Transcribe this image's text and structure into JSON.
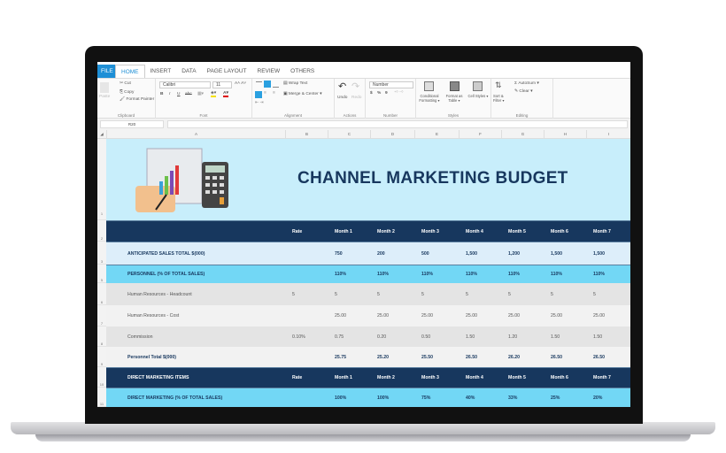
{
  "ribbon": {
    "tabs": [
      "FILE",
      "HOME",
      "INSERT",
      "DATA",
      "PAGE LAYOUT",
      "REVIEW",
      "OTHERS"
    ],
    "clipboard": {
      "paste": "Paste",
      "cut": "Cut",
      "copy": "Copy",
      "format_painter": "Format Painter",
      "label": "Clipboard"
    },
    "font": {
      "name": "Calibri",
      "size": "11",
      "bold": "B",
      "italic": "I",
      "underline": "U",
      "strike": "abc",
      "label": "Font"
    },
    "alignment": {
      "wrap": "Wrap Text",
      "merge": "Merge & Center",
      "label": "Alignment"
    },
    "actions": {
      "undo": "Undo",
      "redo": "Redo",
      "label": "Actions"
    },
    "number": {
      "format": "Number",
      "currency": "$",
      "percent": "%",
      "comma": "9",
      "label": "Number"
    },
    "styles": {
      "conditional": "Conditional Formatting ▾",
      "format_table": "Format as Table ▾",
      "cell_styles": "Cell Styles ▾",
      "label": "Styles"
    },
    "editing": {
      "autosum": "AutoSum ▾",
      "clear": "Clear ▾",
      "sort": "Sort & Filter ▾",
      "label": "Editing"
    }
  },
  "formula_bar": {
    "name_box": "R20",
    "value": ""
  },
  "columns": [
    "A",
    "B",
    "C",
    "D",
    "E",
    "F",
    "G",
    "H",
    "I"
  ],
  "sheet": {
    "title": "CHANNEL MARKETING BUDGET",
    "rows": [
      {
        "num": "2",
        "style": "navy",
        "cells": [
          "",
          "Rate",
          "Month 1",
          "Month 2",
          "Month 3",
          "Month 4",
          "Month 5",
          "Month 6",
          "Month 7"
        ]
      },
      {
        "num": "3",
        "style": "light",
        "cells": [
          "ANTICIPATED SALES TOTAL $(000)",
          "",
          "750",
          "200",
          "500",
          "1,500",
          "1,200",
          "1,500",
          "1,500"
        ]
      },
      {
        "num": "5",
        "style": "cyan",
        "cells": [
          "PERSONNEL (% OF TOTAL SALES)",
          "",
          "110%",
          "110%",
          "110%",
          "110%",
          "110%",
          "110%",
          "110%"
        ]
      },
      {
        "num": "6",
        "style": "grey",
        "cells": [
          "Human Resources - Headcount",
          "5",
          "5",
          "5",
          "5",
          "5",
          "5",
          "5",
          "5"
        ]
      },
      {
        "num": "7",
        "style": "pale",
        "cells": [
          "Human Resources - Cost",
          "",
          "25.00",
          "25.00",
          "25.00",
          "25.00",
          "25.00",
          "25.00",
          "25.00"
        ]
      },
      {
        "num": "8",
        "style": "grey",
        "cells": [
          "Commission",
          "0.10%",
          "0.75",
          "0.20",
          "0.50",
          "1.50",
          "1.20",
          "1.50",
          "1.50"
        ]
      },
      {
        "num": "9",
        "style": "palebold",
        "cells": [
          "Personnel Total $(000)",
          "",
          "25.75",
          "25.20",
          "25.50",
          "26.50",
          "26.20",
          "26.50",
          "26.50"
        ]
      },
      {
        "num": "10",
        "style": "navy",
        "cells": [
          "DIRECT MARKETING ITEMS",
          "Rate",
          "Month 1",
          "Month 2",
          "Month 3",
          "Month 4",
          "Month 5",
          "Month 6",
          "Month 7"
        ]
      },
      {
        "num": "11",
        "style": "cyan",
        "cells": [
          "DIRECT MARKETING (% OF TOTAL SALES)",
          "",
          "100%",
          "100%",
          "75%",
          "40%",
          "33%",
          "25%",
          "20%"
        ]
      }
    ]
  },
  "colors": {
    "navy": "#17375e",
    "cyan": "#72d7f5",
    "light": "#ddeefa",
    "banner": "#c8eefb",
    "accent": "#1e8fd6"
  }
}
